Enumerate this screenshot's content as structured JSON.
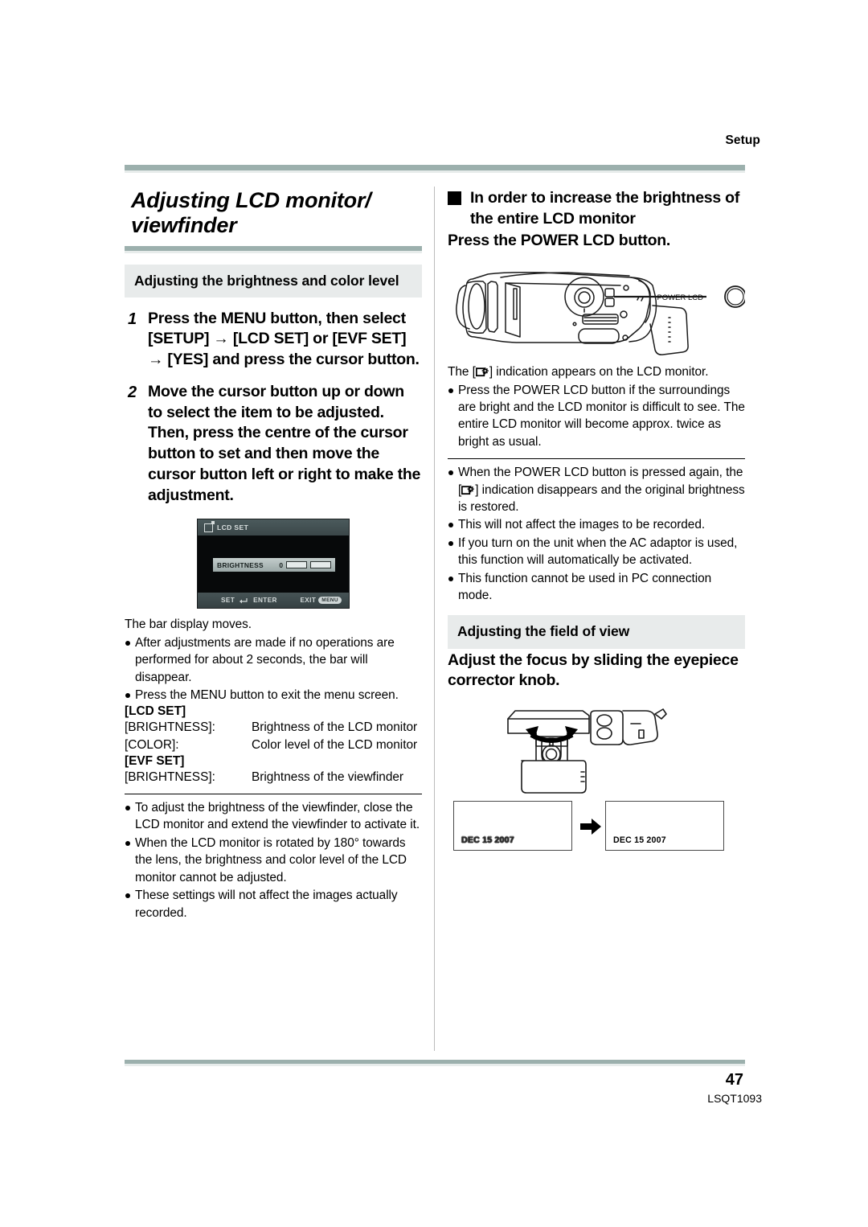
{
  "header": {
    "running_head": "Setup"
  },
  "footer": {
    "page_number": "47",
    "doc_id": "LSQT1093"
  },
  "left_column": {
    "chapter_title": "Adjusting LCD monitor/ viewfinder",
    "section_title": "Adjusting the brightness and color level",
    "steps": [
      {
        "number": "1",
        "text": "Press the MENU button, then select [SETUP] → [LCD SET] or [EVF SET] → [YES] and press the cursor button."
      },
      {
        "number": "2",
        "text": "Move the cursor button up or down to select the item to be adjusted. Then, press the centre of the cursor button to set and then move the cursor button left or right to make the adjustment."
      }
    ],
    "lcd_screen": {
      "title": "LCD SET",
      "row_label": "BRIGHTNESS",
      "row_value": "0",
      "footer_set": "SET",
      "footer_enter": "ENTER",
      "footer_exit": "EXIT",
      "footer_exit_key": "MENU"
    },
    "result_text": "The bar display moves.",
    "notes": [
      "After adjustments are made if no operations are performed for about 2 seconds, the bar will disappear.",
      "Press the MENU button to exit the menu screen."
    ],
    "lcd_set_label": "[LCD SET]",
    "lcd_set_rows": [
      {
        "key": "[BRIGHTNESS]:",
        "value": "Brightness of the LCD monitor"
      },
      {
        "key": "[COLOR]:",
        "value": "Color level of the LCD monitor"
      }
    ],
    "evf_set_label": "[EVF SET]",
    "evf_set_rows": [
      {
        "key": "[BRIGHTNESS]:",
        "value": "Brightness of the viewfinder"
      }
    ],
    "final_notes": [
      "To adjust the brightness of the viewfinder, close the LCD monitor and extend the viewfinder to activate it.",
      "When the LCD monitor is rotated by 180° towards the lens, the brightness and color level of the LCD monitor cannot be adjusted.",
      "These settings will not affect the images actually recorded."
    ]
  },
  "right_column": {
    "square_heading": "In order to increase the brightness of the entire LCD monitor",
    "command_line": "Press the POWER LCD button.",
    "camera_figure": {
      "callout_label": "POWER LCD"
    },
    "indication_text_before": "The [",
    "indication_text_after": "] indication appears on the LCD monitor.",
    "notes_group_1": [
      "Press the POWER LCD button if the surroundings are bright and the LCD monitor is difficult to see. The entire LCD monitor will become approx. twice as bright as usual."
    ],
    "note_power_again_1": "When the POWER LCD button is pressed again, the [",
    "note_power_again_2": "] indication disappears and the original brightness is restored.",
    "notes_group_2": [
      "This will not affect the images to be recorded.",
      "If you turn on the unit when the AC adaptor is used, this function will automatically be activated.",
      "This function cannot be used in PC connection mode."
    ],
    "section_title_2": "Adjusting the field of view",
    "command_line_2": "Adjust the focus by sliding the eyepiece corrector knob.",
    "date_boxes": [
      {
        "text": "DEC 15 2007",
        "state": "blurry"
      },
      {
        "text": "DEC 15 2007",
        "state": "sharp"
      }
    ]
  },
  "colors": {
    "rule_accent": "#9cb0ad",
    "rule_light": "#e7eceb",
    "band_bg": "#e8ebeb",
    "divider": "#bcbcbc"
  }
}
